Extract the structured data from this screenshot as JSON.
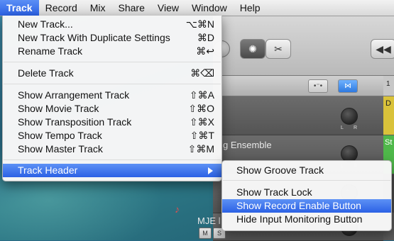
{
  "menubar": {
    "items": [
      "Track",
      "Record",
      "Mix",
      "Share",
      "View",
      "Window",
      "Help"
    ]
  },
  "track_menu": {
    "items": [
      {
        "label": "New Track...",
        "shortcut": "⌥⌘N"
      },
      {
        "label": "New Track With Duplicate Settings",
        "shortcut": "⌘D"
      },
      {
        "label": "Rename Track",
        "shortcut": "⌘↩"
      },
      {
        "label": "Delete Track",
        "shortcut": "⌘⌫"
      },
      {
        "label": "Show Arrangement Track",
        "shortcut": "⇧⌘A"
      },
      {
        "label": "Show Movie Track",
        "shortcut": "⇧⌘O"
      },
      {
        "label": "Show Transposition Track",
        "shortcut": "⇧⌘X"
      },
      {
        "label": "Show Tempo Track",
        "shortcut": "⇧⌘T"
      },
      {
        "label": "Show Master Track",
        "shortcut": "⇧⌘M"
      },
      {
        "label": "Track Header",
        "shortcut": ""
      }
    ]
  },
  "track_header_submenu": {
    "items": [
      "Show Groove Track",
      "Show Track Lock",
      "Show Record Enable Button",
      "Hide Input Monitoring Button"
    ],
    "highlighted": "Show Record Enable Button"
  },
  "app_window": {
    "tracks": [
      {
        "name": "g Ensemble"
      },
      {
        "name": "MJE l"
      }
    ],
    "knob_labels": [
      "L",
      "R"
    ],
    "mute_label": "M",
    "solo_label": "S",
    "region_labels": [
      "D",
      "St"
    ],
    "region_colors": [
      "#d9c23a",
      "#4fb84a"
    ],
    "ruler_number": "1"
  },
  "colors": {
    "highlight": "#2b61e5",
    "menu_bg": "#f7f7f7"
  }
}
